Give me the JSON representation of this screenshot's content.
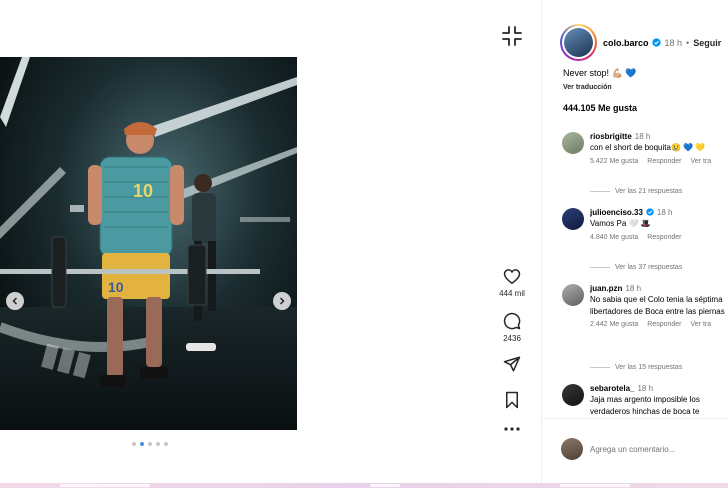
{
  "post": {
    "author": "colo.barco",
    "time": "18 h",
    "separator": "•",
    "follow_label": "Seguir",
    "caption": "Never stop! 💪🏼 💙",
    "translate_label": "Ver traducción",
    "likes_total": "444.105 Me gusta"
  },
  "actions": {
    "like_count": "444 mil",
    "comment_count": "2436"
  },
  "carousel": {
    "total": 5,
    "active_index": 1
  },
  "comments": [
    {
      "user": "riosbrigitte",
      "time": "18 h",
      "verified": false,
      "text": "con el short de boquita😢 💙 💛",
      "likes": "5.422 Me gusta",
      "reply_label": "Responder",
      "translate_label": "Ver tra",
      "replies_label": "Ver las 21 respuestas"
    },
    {
      "user": "julioenciso.33",
      "time": "18 h",
      "verified": true,
      "text": "Vamos Pa 🤍 🎩",
      "likes": "4.840 Me gusta",
      "reply_label": "Responder",
      "translate_label": "",
      "replies_label": "Ver las 37 respuestas"
    },
    {
      "user": "juan.pzn",
      "time": "18 h",
      "verified": false,
      "text": "No sabia que el Colo tenia la séptima libertadores de Boca entre las piernas",
      "likes": "2.442 Me gusta",
      "reply_label": "Responder",
      "translate_label": "Ver tra",
      "replies_label": "Ver las 15 respuestas"
    },
    {
      "user": "sebarotela_",
      "time": "18 h",
      "verified": false,
      "text": "Jaja mas argento imposible los verdaderos hinchas de boca te",
      "likes": "",
      "reply_label": "",
      "translate_label": "",
      "replies_label": ""
    }
  ],
  "comment_input": {
    "placeholder": "Agrega un comentario..."
  },
  "icons": {
    "collapse": "collapse-icon",
    "like": "heart-icon",
    "comment": "comment-bubble-icon",
    "share": "paper-plane-icon",
    "save": "bookmark-icon",
    "more": "more-dots-icon"
  },
  "colors": {
    "verified": "#0095f6",
    "secondary_text": "#737373",
    "carousel_active_dot": "#4a90d9"
  }
}
